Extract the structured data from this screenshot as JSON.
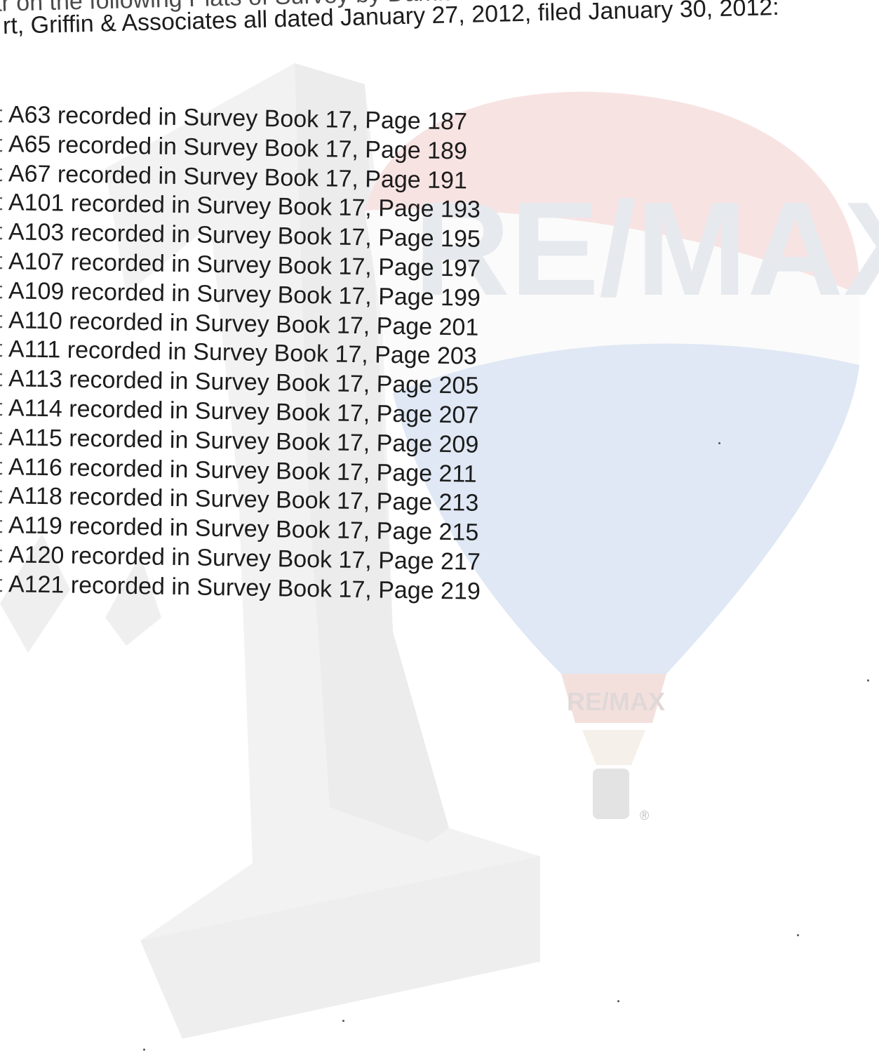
{
  "document": {
    "intro_line_1": "appear on the following Plats of Survey by Damian P. Greble, L.S.,",
    "intro_line_2": "rt, Griffin & Associates all dated January 27, 2012, filed January 30, 2012:",
    "plats": [
      {
        "prefix": "t",
        "text": "A63 recorded in Survey Book 17, Page 187"
      },
      {
        "prefix": "t",
        "text": "A65 recorded in Survey Book 17, Page 189"
      },
      {
        "prefix": "t",
        "text": "A67 recorded in Survey Book 17, Page 191"
      },
      {
        "prefix": "t",
        "text": "A101 recorded in Survey Book 17, Page 193"
      },
      {
        "prefix": "t",
        "text": "A103 recorded in Survey Book 17, Page 195"
      },
      {
        "prefix": "t",
        "text": "A107 recorded in Survey Book 17, Page 197"
      },
      {
        "prefix": "t",
        "text": "A109 recorded in Survey Book 17, Page 199"
      },
      {
        "prefix": "t",
        "text": "A110 recorded in Survey Book 17, Page 201"
      },
      {
        "prefix": "t",
        "text": "A111 recorded in Survey Book 17, Page 203"
      },
      {
        "prefix": "t",
        "text": "A113 recorded in Survey Book 17, Page 205"
      },
      {
        "prefix": "t",
        "text": "A114 recorded in Survey Book 17, Page 207"
      },
      {
        "prefix": "t",
        "text": "A115 recorded in Survey Book 17, Page 209"
      },
      {
        "prefix": "t",
        "text": "A116 recorded in Survey Book 17, Page 211"
      },
      {
        "prefix": "t",
        "text": "A118 recorded in Survey Book 17, Page 213"
      },
      {
        "prefix": "t",
        "text": "A119 recorded in Survey Book 17, Page 215"
      },
      {
        "prefix": "t",
        "text": "A120 recorded in Survey Book 17, Page 217"
      },
      {
        "prefix": "t",
        "text": "A121 recorded in Survey Book 17, Page 219"
      }
    ]
  },
  "watermark": {
    "logo_text": "RE/MAX",
    "basket_text": "RE/MAX",
    "registered_mark": "®",
    "colors": {
      "red": "#f7dede",
      "blue": "#dfe8f4",
      "white": "#fbfbfb",
      "number_one": "#f1f1f1"
    }
  }
}
